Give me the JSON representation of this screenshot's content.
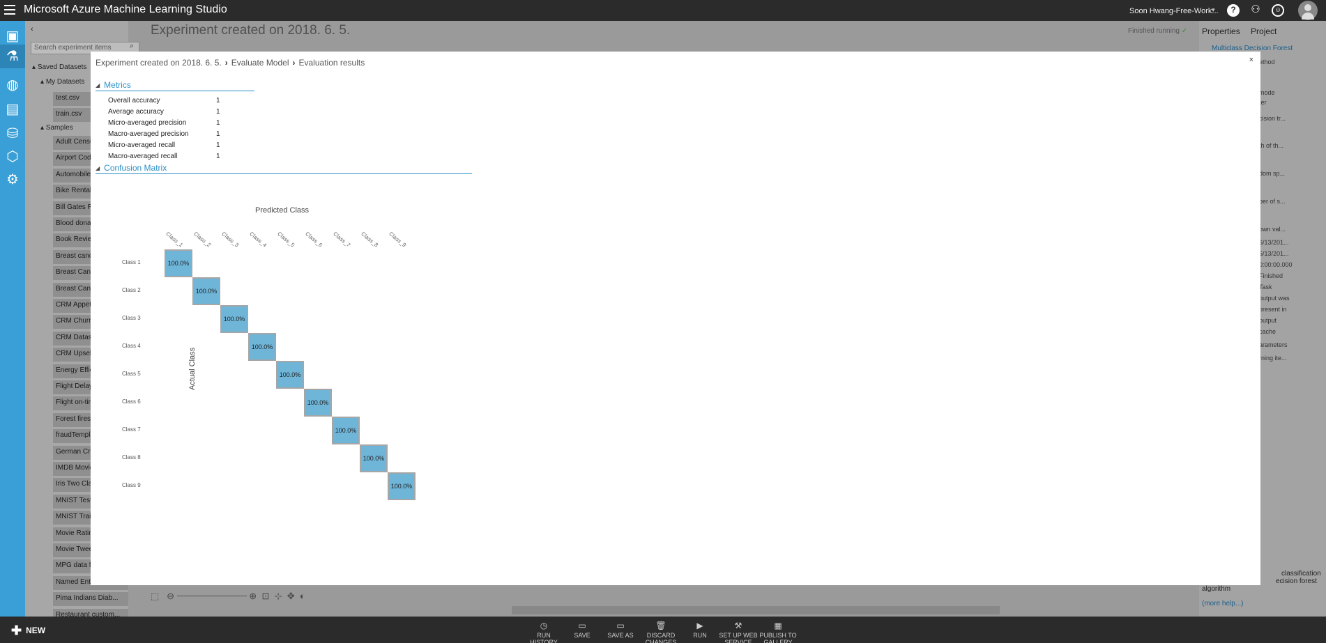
{
  "topbar": {
    "app_title": "Microsoft Azure Machine Learning Studio",
    "user": "Soon Hwang-Free-Work...",
    "help_icon": "?",
    "people_icon": "people-icon",
    "smiley_icon": "smiley-icon"
  },
  "palette": {
    "search_placeholder": "Search experiment items",
    "saved_datasets": "Saved Datasets",
    "my_datasets": "My Datasets",
    "my_items": [
      "test.csv",
      "train.csv"
    ],
    "samples": "Samples",
    "sample_items": [
      "Adult Census",
      "Airport Code",
      "Automobile",
      "Bike Rental",
      "Bill Gates RG",
      "Blood donat",
      "Book Review",
      "Breast cance",
      "Breast Cance",
      "Breast Cance",
      "CRM Appete",
      "CRM Churn",
      "CRM Datase",
      "CRM Upsell",
      "Energy Effici",
      "Flight Delay",
      "Flight on-tin",
      "Forest fires",
      "fraudTempla",
      "German Cre",
      "IMDB Movie",
      "Iris Two Clas",
      "MNIST Test",
      "MNIST Train",
      "Movie Ratin",
      "Movie Twee",
      "MPG data fo",
      "Named Enti",
      "Pima Indians Diab...",
      "Restaurant custom..."
    ]
  },
  "canvas": {
    "title": "Experiment created on 2018. 6. 5.",
    "status": "Finished running",
    "status_icon": "✓"
  },
  "properties": {
    "tab_properties": "Properties",
    "tab_project": "Project",
    "module_name": "Multiclass Decision Forest",
    "fragments": [
      "ethod",
      "mode",
      "ter",
      "cision tr...",
      "th of th...",
      "dom sp...",
      "ber of s...",
      "own val...",
      "6/13/201...",
      "6/13/201...",
      "0:00:00.000",
      "Finished",
      "Task",
      "output was",
      "present in",
      "output",
      "cache",
      "arameters",
      "rning ite..."
    ],
    "help_text_1": "classification",
    "help_text_2": "ecision forest",
    "help_text_3": "algorithm",
    "more_help": "(more help...)"
  },
  "bottombar": {
    "new_label": "NEW",
    "buttons": [
      {
        "label": "RUN HISTORY",
        "icon": "history-icon"
      },
      {
        "label": "SAVE",
        "icon": "save-icon"
      },
      {
        "label": "SAVE AS",
        "icon": "save-as-icon"
      },
      {
        "label": "DISCARD CHANGES",
        "icon": "trash-icon"
      },
      {
        "label": "RUN",
        "icon": "run-icon"
      },
      {
        "label": "SET UP WEB SERVICE",
        "icon": "web-service-icon"
      },
      {
        "label": "PUBLISH TO GALLERY",
        "icon": "gallery-icon"
      }
    ]
  },
  "modal": {
    "breadcrumb": [
      "Experiment created on 2018. 6. 5.",
      "Evaluate Model",
      "Evaluation results"
    ],
    "close_label": "×",
    "metrics_title": "Metrics",
    "metrics": [
      {
        "name": "Overall accuracy",
        "value": "1"
      },
      {
        "name": "Average accuracy",
        "value": "1"
      },
      {
        "name": "Micro-averaged precision",
        "value": "1"
      },
      {
        "name": "Macro-averaged precision",
        "value": "1"
      },
      {
        "name": "Micro-averaged recall",
        "value": "1"
      },
      {
        "name": "Macro-averaged recall",
        "value": "1"
      }
    ],
    "confusion_title": "Confusion Matrix",
    "predicted_label": "Predicted Class",
    "actual_label": "Actual Class",
    "col_labels": [
      "Class_1",
      "Class_2",
      "Class_3",
      "Class_4",
      "Class_5",
      "Class_6",
      "Class_7",
      "Class_8",
      "Class_9"
    ],
    "row_labels": [
      "Class 1",
      "Class 2",
      "Class 3",
      "Class 4",
      "Class 5",
      "Class 6",
      "Class 7",
      "Class 8",
      "Class 9"
    ],
    "diagonal_values": [
      "100.0%",
      "100.0%",
      "100.0%",
      "100.0%",
      "100.0%",
      "100.0%",
      "100.0%",
      "100.0%",
      "100.0%"
    ]
  }
}
